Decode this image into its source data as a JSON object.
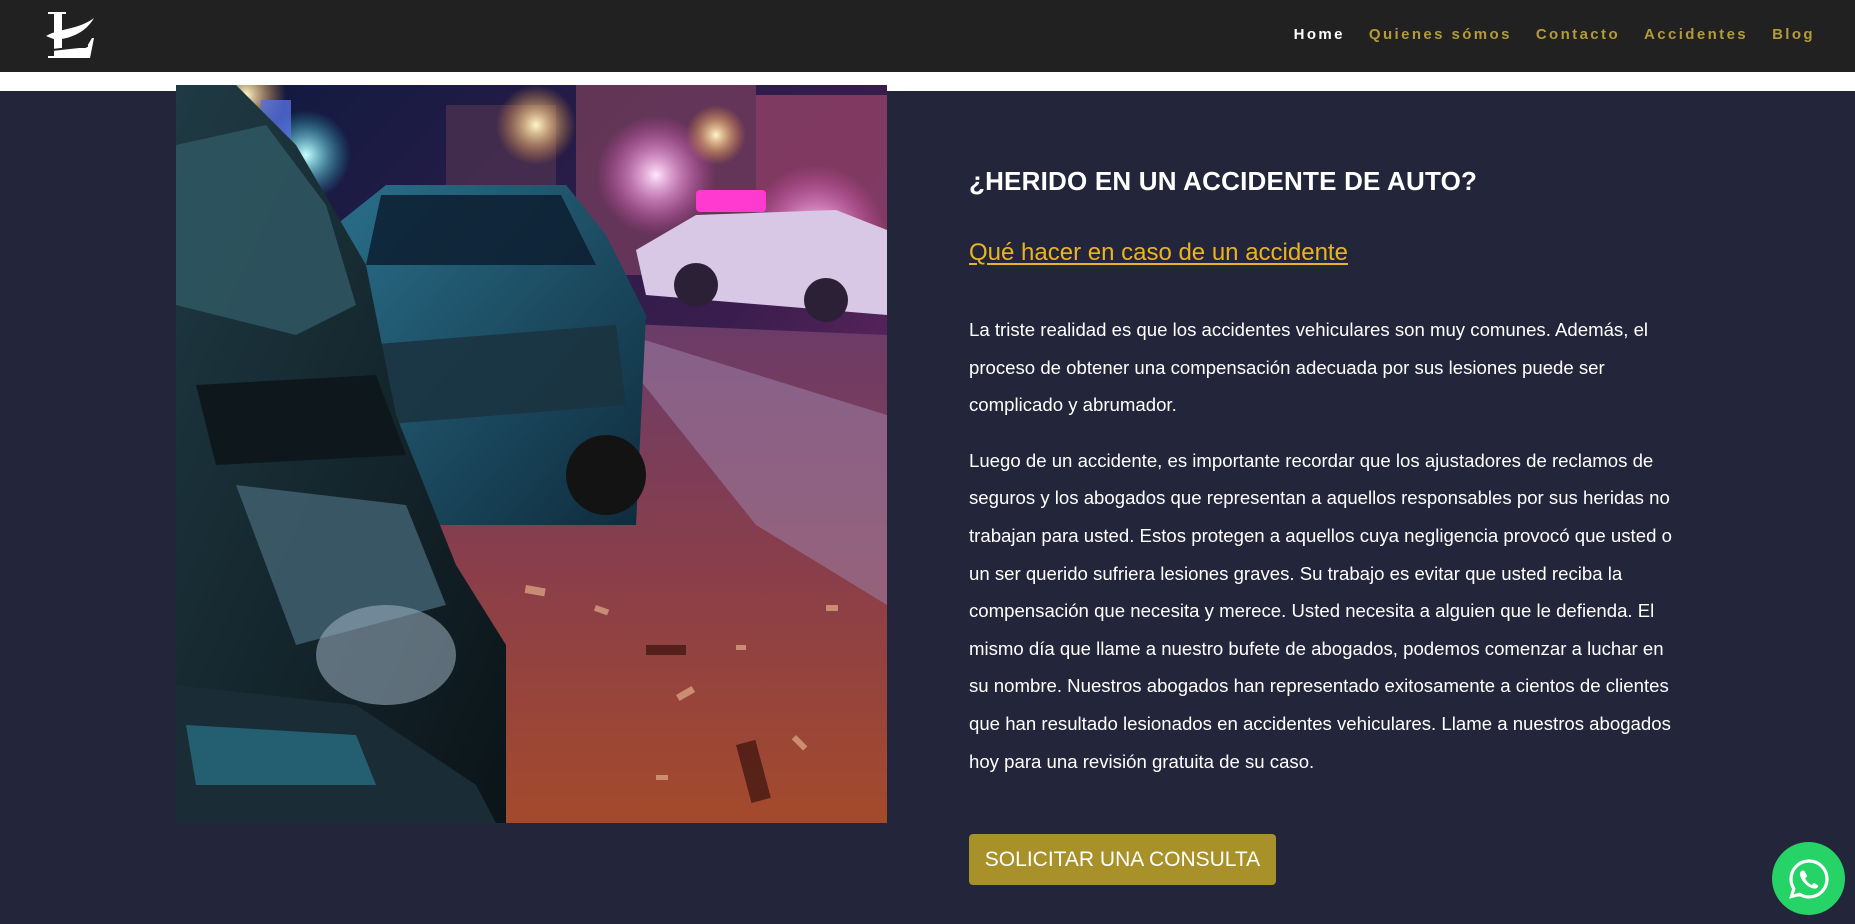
{
  "colors": {
    "nav_background": "#212121",
    "page_background": "#23253a",
    "nav_link": "#b39a3a",
    "nav_active": "#ffffff",
    "link_accent": "#e8b423",
    "cta_background": "#a79128",
    "whatsapp": "#25d366"
  },
  "header": {
    "logo_icon": "law-firm-logo-icon",
    "nav": [
      {
        "label": "Home",
        "active": true
      },
      {
        "label": "Quienes sómos"
      },
      {
        "label": "Contacto"
      },
      {
        "label": "Accidentes"
      },
      {
        "label": "Blog"
      }
    ]
  },
  "hero": {
    "image_icon": "car-accident-photo"
  },
  "main": {
    "heading": "¿HERIDO EN UN ACCIDENTE DE AUTO?",
    "link": "Qué hacer en caso de un accidente",
    "paragraph1": "La triste realidad es que los accidentes vehiculares son muy comunes. Además, el proceso de obtener una compensación adecuada por sus lesiones puede ser complicado y abrumador.",
    "paragraph2": "Luego de un accidente, es importante recordar que los ajustadores de reclamos de seguros y los abogados que representan a aquellos responsables por sus heridas no trabajan para usted. Estos protegen a aquellos cuya negligencia provocó que usted o un ser querido sufriera lesiones graves. Su trabajo es evitar que usted reciba la compensación que necesita y merece. Usted necesita a alguien que le defienda. El mismo día que llame a nuestro bufete de abogados, podemos comenzar a luchar en su nombre. Nuestros abogados han representado exitosamente a cientos de clientes que han resultado lesionados en accidentes vehiculares. Llame a nuestros abogados hoy para una revisión gratuita de su caso.",
    "cta_label": "SOLICITAR UNA CONSULTA"
  },
  "floating": {
    "whatsapp_icon": "whatsapp-icon"
  }
}
